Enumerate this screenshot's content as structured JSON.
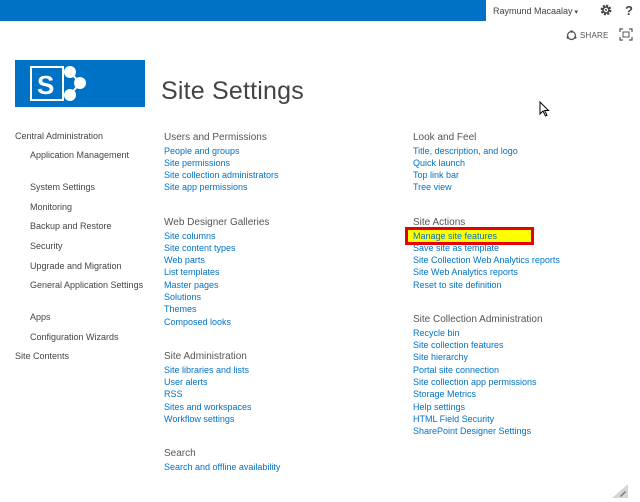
{
  "user": {
    "name": "Raymund Macaalay"
  },
  "toolbar": {
    "share_label": "SHARE"
  },
  "page": {
    "title": "Site Settings"
  },
  "leftnav": {
    "central_admin": "Central Administration",
    "items": [
      "Application Management",
      "System Settings",
      "Monitoring",
      "Backup and Restore",
      "Security",
      "Upgrade and Migration",
      "General Application Settings",
      "Apps",
      "Configuration Wizards"
    ],
    "site_contents": "Site Contents"
  },
  "sections": {
    "users": {
      "title": "Users and Permissions",
      "links": [
        "People and groups",
        "Site permissions",
        "Site collection administrators",
        "Site app permissions"
      ]
    },
    "galleries": {
      "title": "Web Designer Galleries",
      "links": [
        "Site columns",
        "Site content types",
        "Web parts",
        "List templates",
        "Master pages",
        "Solutions",
        "Themes",
        "Composed looks"
      ]
    },
    "admin": {
      "title": "Site Administration",
      "links": [
        "Site libraries and lists",
        "User alerts",
        "RSS",
        "Sites and workspaces",
        "Workflow settings"
      ]
    },
    "search": {
      "title": "Search",
      "links": [
        "Search and offline availability"
      ]
    },
    "look": {
      "title": "Look and Feel",
      "links": [
        "Title, description, and logo",
        "Quick launch",
        "Top link bar",
        "Tree view"
      ]
    },
    "actions": {
      "title": "Site Actions",
      "links": [
        "Manage site features",
        "Save site as template",
        "Site Collection Web Analytics reports",
        "Site Web Analytics reports",
        "Reset to site definition"
      ]
    },
    "collection": {
      "title": "Site Collection Administration",
      "links": [
        "Recycle bin",
        "Site collection features",
        "Site hierarchy",
        "Portal site connection",
        "Site collection app permissions",
        "Storage Metrics",
        "Help settings",
        "HTML Field Security",
        "SharePoint Designer Settings"
      ]
    }
  },
  "colors": {
    "brand": "#0072c6",
    "highlight": "#ffff00",
    "highlight_border": "#e60000"
  }
}
